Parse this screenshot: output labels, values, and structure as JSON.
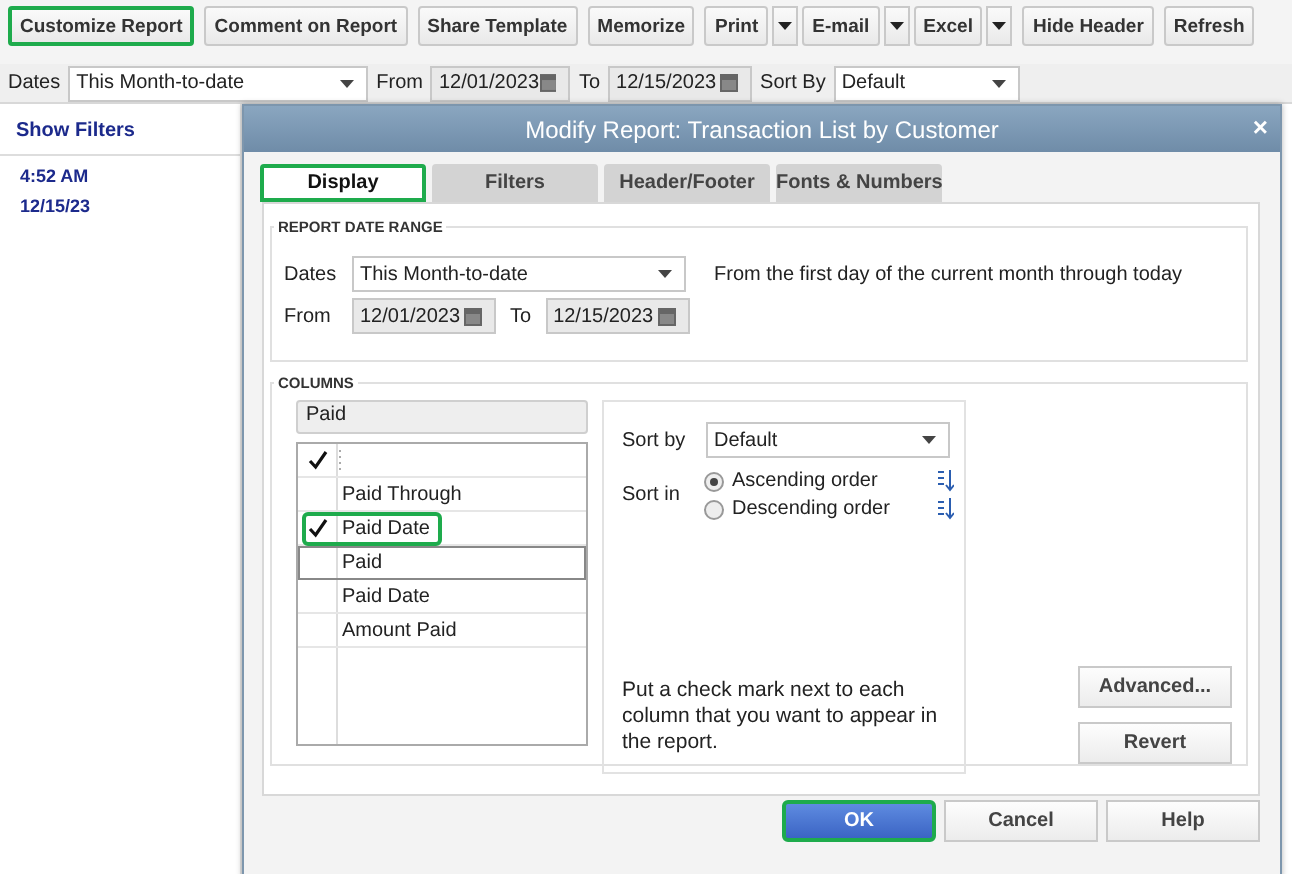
{
  "toolbar": {
    "buttons": [
      {
        "label": "Customize Report",
        "kind": "button",
        "highlighted": true
      },
      {
        "label": "Comment on Report",
        "kind": "button",
        "highlighted": false
      },
      {
        "label": "Share Template",
        "kind": "button",
        "highlighted": false
      },
      {
        "label": "Memorize",
        "kind": "button",
        "highlighted": false
      },
      {
        "label": "Print",
        "kind": "split",
        "highlighted": false
      },
      {
        "label": "E-mail",
        "kind": "split",
        "highlighted": false
      },
      {
        "label": "Excel",
        "kind": "split",
        "highlighted": false
      },
      {
        "label": "Hide Header",
        "kind": "button",
        "highlighted": false
      },
      {
        "label": "Refresh",
        "kind": "button",
        "highlighted": false
      }
    ]
  },
  "filter_bar": {
    "dates_label": "Dates",
    "dates_value": "This Month-to-date",
    "from_label": "From",
    "from_value": "12/01/2023",
    "to_label": "To",
    "to_value": "12/15/2023",
    "sort_label": "Sort By",
    "sort_value": "Default"
  },
  "report": {
    "show_filters": "Show Filters",
    "time": "4:52 AM",
    "date": "12/15/23"
  },
  "dialog": {
    "title": "Modify Report: Transaction List by Customer",
    "close": "×",
    "tabs": [
      {
        "label": "Display",
        "selected": true,
        "highlighted": true
      },
      {
        "label": "Filters",
        "selected": false,
        "highlighted": false
      },
      {
        "label": "Header/Footer",
        "selected": false,
        "highlighted": false
      },
      {
        "label": "Fonts & Numbers",
        "selected": false,
        "highlighted": false
      }
    ],
    "date_range": {
      "heading": "REPORT DATE RANGE",
      "dates_label": "Dates",
      "dates_value": "This Month-to-date",
      "description": "From the first day of the current month through today",
      "from_label": "From",
      "from_value": "12/01/2023",
      "to_label": "To",
      "to_value": "12/15/2023"
    },
    "columns": {
      "heading": "COLUMNS",
      "search_value": "Paid",
      "items": [
        {
          "label": "Paid Through",
          "checked": false,
          "selected": false,
          "highlighted": false
        },
        {
          "label": "Paid Date",
          "checked": true,
          "selected": false,
          "highlighted": true
        },
        {
          "label": "Paid",
          "checked": false,
          "selected": true,
          "highlighted": false
        },
        {
          "label": "Paid Date",
          "checked": false,
          "selected": false,
          "highlighted": false
        },
        {
          "label": "Amount Paid",
          "checked": false,
          "selected": false,
          "highlighted": false
        }
      ],
      "sort_by_label": "Sort by",
      "sort_by_value": "Default",
      "sort_in_label": "Sort in",
      "sort_orders": [
        {
          "label": "Ascending order",
          "selected": true
        },
        {
          "label": "Descending order",
          "selected": false
        }
      ],
      "hint": "Put a check mark next to each column that you want to appear in the report.",
      "advanced": "Advanced...",
      "revert": "Revert"
    },
    "buttons": [
      {
        "label": "OK",
        "kind": "primary",
        "highlighted": true
      },
      {
        "label": "Cancel",
        "kind": "normal",
        "highlighted": false
      },
      {
        "label": "Help",
        "kind": "normal",
        "highlighted": false
      }
    ]
  }
}
